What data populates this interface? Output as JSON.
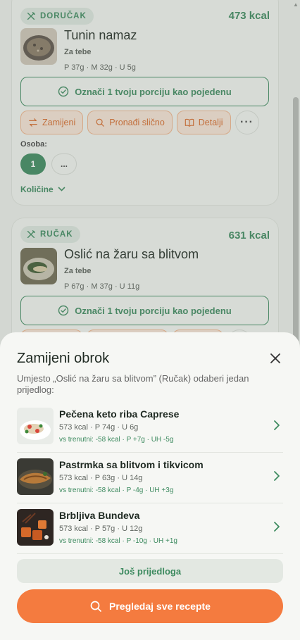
{
  "meals": [
    {
      "type": "DORUČAK",
      "kcal": "473 kcal",
      "title": "Tunin namaz",
      "subtitle": "Za tebe",
      "macros": "P 37g · M 32g · U 5g",
      "eat_label": "Označi 1 tvoju porciju kao pojedenu",
      "actions": {
        "replace": "Zamijeni",
        "find_similar": "Pronađi slično",
        "details": "Detalji",
        "more": "···"
      },
      "persons_label": "Osoba:",
      "persons_selected": "1",
      "persons_other": "...",
      "quantities_label": "Količine"
    },
    {
      "type": "RUČAK",
      "kcal": "631 kcal",
      "title": "Oslić na žaru sa blitvom",
      "subtitle": "Za tebe",
      "macros": "P 67g · M 37g · U 11g",
      "eat_label": "Označi 1 tvoju porciju kao pojedenu"
    }
  ],
  "sheet": {
    "title": "Zamijeni obrok",
    "description": "Umjesto „Oslić na žaru sa blitvom” (Ručak) odaberi jedan prijedlog:",
    "suggestions": [
      {
        "name": "Pečena keto riba Caprese",
        "macros": "573 kcal · P 74g · U 6g",
        "diff": "vs trenutni: -58 kcal · P +7g · UH -5g"
      },
      {
        "name": "Pastrmka sa blitvom i tikvicom",
        "macros": "573 kcal · P 63g · U 14g",
        "diff": "vs trenutni: -58 kcal · P -4g · UH +3g"
      },
      {
        "name": "Brbljiva Bundeva",
        "macros": "573 kcal · P 57g · U 12g",
        "diff": "vs trenutni: -58 kcal · P -10g · UH +1g"
      }
    ],
    "more_label": "Još prijedloga",
    "browse_label": "Pregledaj sve recepte"
  },
  "colors": {
    "accent_green": "#3d8a5f",
    "accent_orange": "#f47b3f"
  },
  "icons": [
    "utensils-icon",
    "check-circle-icon",
    "swap-icon",
    "search-icon",
    "book-icon",
    "chevron-down-icon",
    "close-icon",
    "chevron-right-icon"
  ]
}
